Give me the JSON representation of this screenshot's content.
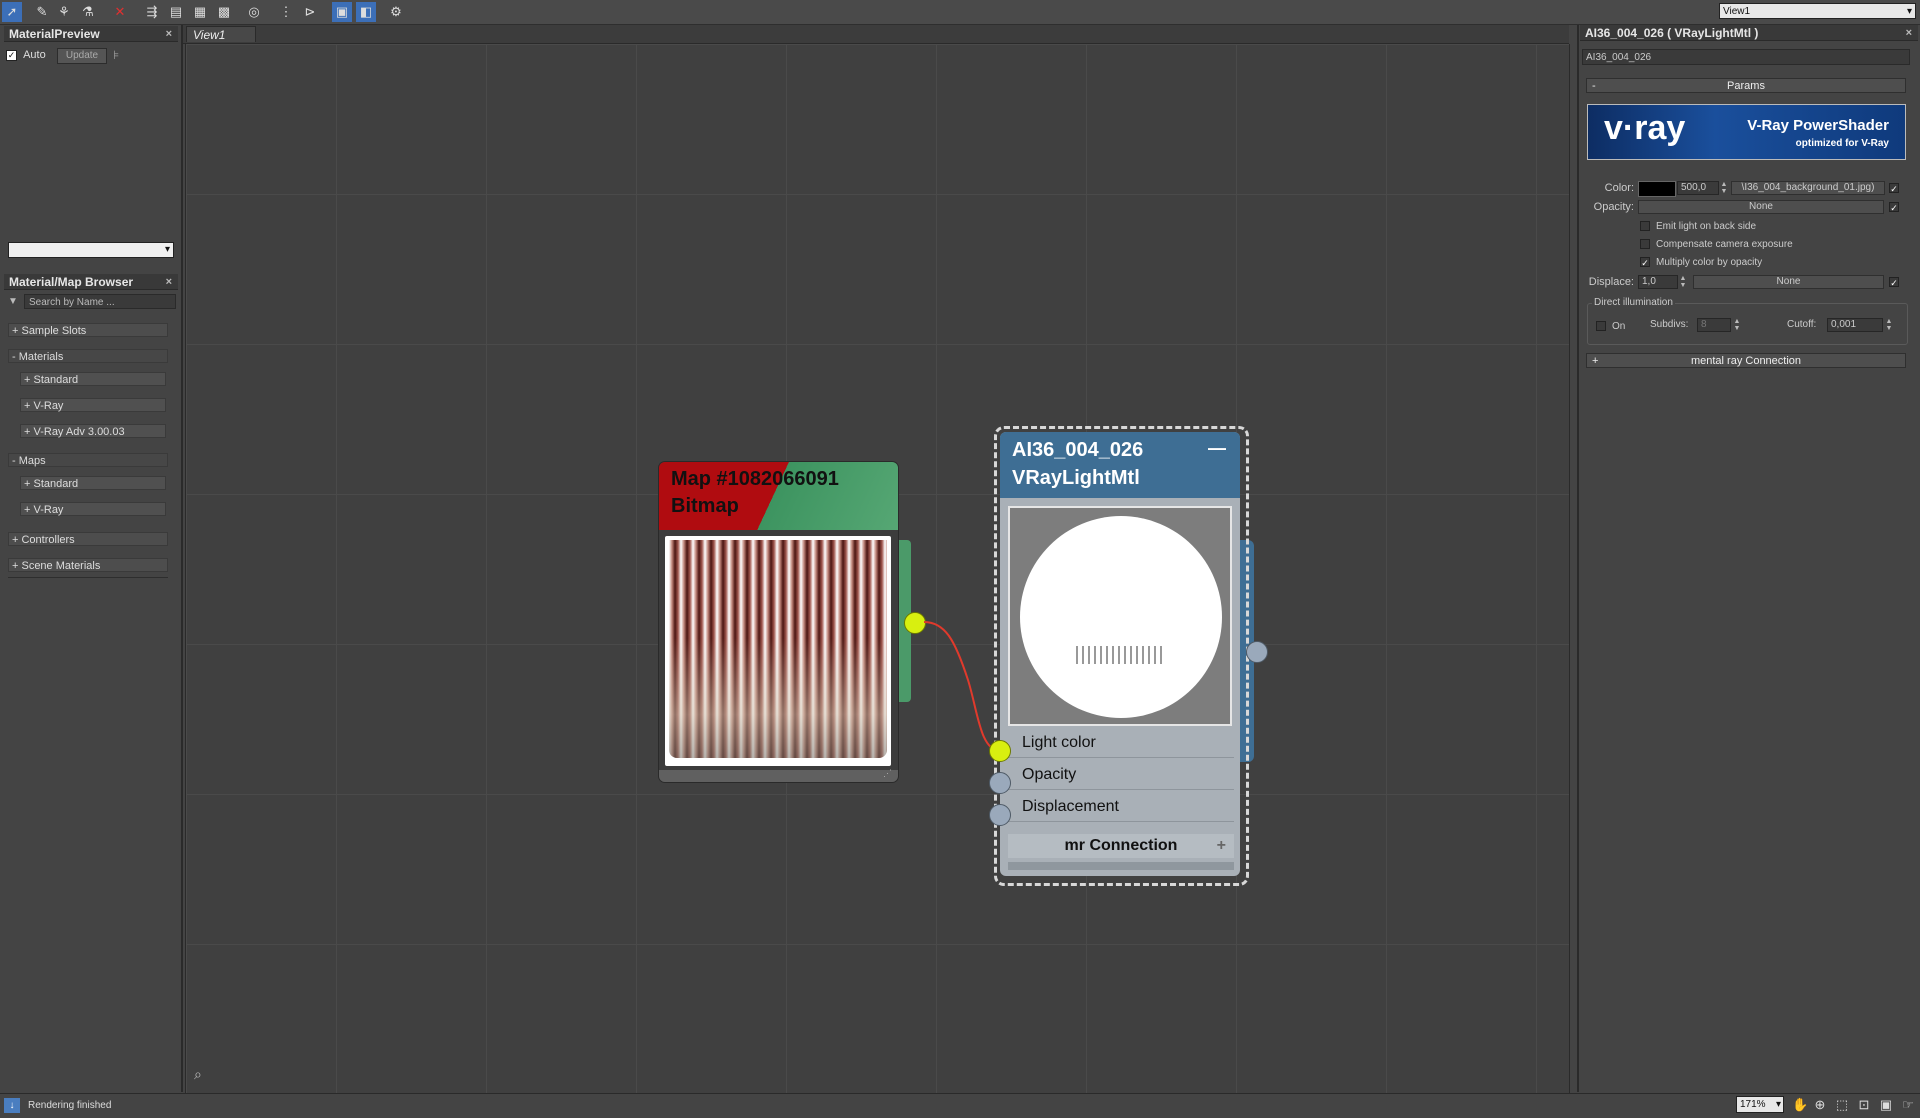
{
  "toolbar": {
    "icons": [
      "select-tool-icon",
      "pick-material-icon",
      "get-material-icon",
      "put-material-icon",
      "delete-icon",
      "move-children-icon",
      "hide-unused-icon",
      "show-map-icon",
      "show-background-icon",
      "layout-icon",
      "layout-all-icon",
      "layout-children-icon",
      "material-map-navigator-icon",
      "parameter-editor-icon",
      "select-by-material-icon"
    ],
    "view_select": "View1"
  },
  "material_preview": {
    "title": "MaterialPreview",
    "auto_label": "Auto",
    "auto_checked": true,
    "update_label": "Update"
  },
  "browser": {
    "title": "Material/Map Browser",
    "search_placeholder": "Search by Name ...",
    "groups": [
      {
        "label": "+ Sample Slots"
      },
      {
        "label": "- Materials"
      },
      {
        "label": "+ Standard"
      },
      {
        "label": "+ V-Ray"
      },
      {
        "label": "+ V-Ray Adv 3.00.03"
      },
      {
        "label": "- Maps"
      },
      {
        "label": "+ Standard"
      },
      {
        "label": "+ V-Ray"
      },
      {
        "label": "+ Controllers"
      },
      {
        "label": "+ Scene Materials"
      }
    ]
  },
  "view": {
    "tab_label": "View1"
  },
  "nodes": {
    "bitmap": {
      "name": "Map #1082066091",
      "type": "Bitmap"
    },
    "vray": {
      "name": "AI36_004_026",
      "type": "VRayLightMtl",
      "minimize": "—",
      "slots": [
        "Light color",
        "Opacity",
        "Displacement"
      ],
      "mr_label": "mr Connection",
      "mr_plus": "+"
    }
  },
  "params": {
    "title": "AI36_004_026  ( VRayLightMtl )",
    "name_field": "AI36_004_026",
    "rollout_label": "Params",
    "rollout_toggle": "-",
    "banner_logo": "v·ray",
    "banner_title": "V-Ray PowerShader",
    "banner_sub": "optimized for V-Ray",
    "color_label": "Color:",
    "color_value": "500,0",
    "color_swatch": "#000000",
    "color_map": "\\I36_004_background_01.jpg)",
    "opacity_label": "Opacity:",
    "opacity_map": "None",
    "emit_back_label": "Emit light on back side",
    "emit_back_checked": false,
    "compensate_label": "Compensate camera exposure",
    "compensate_checked": false,
    "multiply_label": "Multiply color by opacity",
    "multiply_checked": true,
    "displace_label": "Displace:",
    "displace_value": "1,0",
    "displace_map": "None",
    "direct_label": "Direct illumination",
    "on_label": "On",
    "on_checked": false,
    "subdivs_label": "Subdivs:",
    "subdivs_value": "8",
    "cutoff_label": "Cutoff:",
    "cutoff_value": "0,001",
    "mr_rollout_label": "mental ray Connection",
    "mr_rollout_toggle": "+"
  },
  "status": {
    "text": "Rendering finished",
    "zoom": "171%"
  },
  "colors": {
    "bitmap_header_red": "#b00c10",
    "bitmap_header_green": "#4f9f6c",
    "vray_header": "#3e6e94",
    "port_active": "#d8ef10",
    "wire": "#e03a2c"
  }
}
